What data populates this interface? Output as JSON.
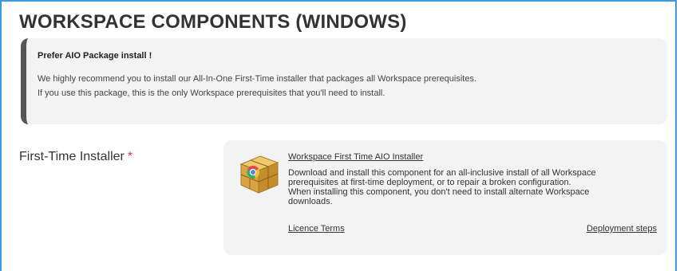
{
  "header": {
    "title": "WORKSPACE COMPONENTS (WINDOWS)"
  },
  "notice": {
    "title": "Prefer AIO Package install !",
    "lines": [
      "We highly recommend you to install our All-In-One First-Time installer that packages all Workspace prerequisites.",
      "If you use this package, this is the only Workspace prerequisites that you'll need to install."
    ]
  },
  "field": {
    "label": "First-Time Installer",
    "required_mark": "*"
  },
  "component": {
    "icon": "package-box-icon",
    "link_text": "Workspace First Time AIO Installer",
    "description_lines": [
      "Download and install this component for an all-inclusive install of all Workspace",
      "prerequisites at first-time deployment, or to repair a broken configuration.",
      "When installing this component, you don't need to install alternate Workspace",
      "downloads."
    ],
    "licence_link": "Licence Terms",
    "steps_link": "Deployment steps"
  },
  "colors": {
    "frame_border": "#3a9be0",
    "required": "#e53935",
    "notice_bar": "#555555",
    "card_background": "#f3f3f3"
  }
}
